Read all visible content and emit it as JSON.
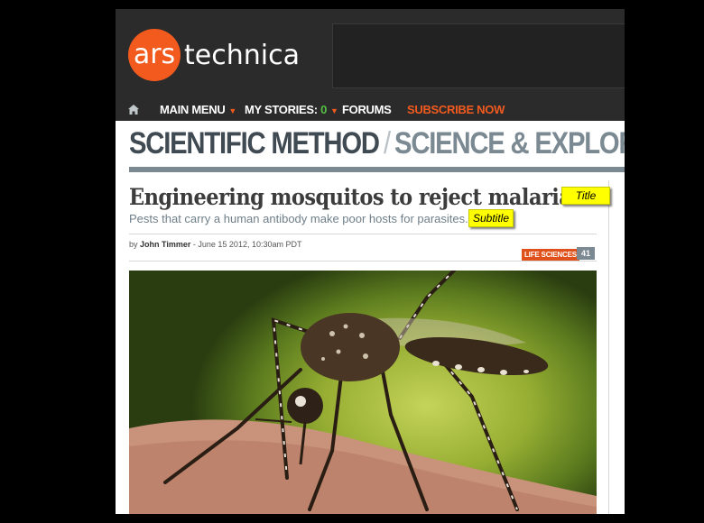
{
  "brand": {
    "logo_ars": "ars",
    "logo_technica": "technica",
    "accent": "#f25a1e"
  },
  "nav": {
    "home_icon": "home-icon",
    "main_menu": "MAIN MENU",
    "my_stories": "MY STORIES:",
    "my_stories_count": "0",
    "forums": "FORUMS",
    "subscribe": "SUBSCRIBE NOW"
  },
  "section": {
    "main": "SCIENTIFIC METHOD",
    "separator": "/",
    "sub": "SCIENCE & EXPLORATION"
  },
  "article": {
    "title": "Engineering mosquitos to reject malaria",
    "subtitle": "Pests that carry a human antibody make poor hosts for parasites.",
    "byline_prefix": "by",
    "author": "John Timmer",
    "date": "- June 15 2012, 10:30am PDT",
    "tag": "LIFE SCIENCES",
    "comments": "41"
  },
  "annotations": {
    "title_note": "Title",
    "subtitle_note": "Subtitle"
  }
}
